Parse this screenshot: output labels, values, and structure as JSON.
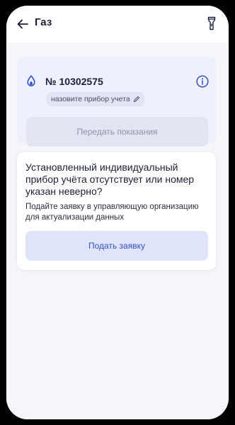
{
  "header": {
    "title": "Газ"
  },
  "meter": {
    "number": "№ 10302575",
    "name_placeholder": "назовите прибор учета",
    "submit_label": "Передать показания"
  },
  "notice": {
    "title": "Установленный индивидуальный прибор учёта отсутствует или номер указан неверно?",
    "text": "Подайте заявку в управляющую организацию для актуализации данных",
    "button_label": "Подать заявку"
  },
  "colors": {
    "accent": "#3350c4",
    "card_bg": "#eef0fb",
    "page_bg": "#f5f6fa"
  },
  "icons": [
    "back-arrow-icon",
    "flashlight-icon",
    "gas-drop-icon",
    "info-icon",
    "pencil-icon"
  ]
}
